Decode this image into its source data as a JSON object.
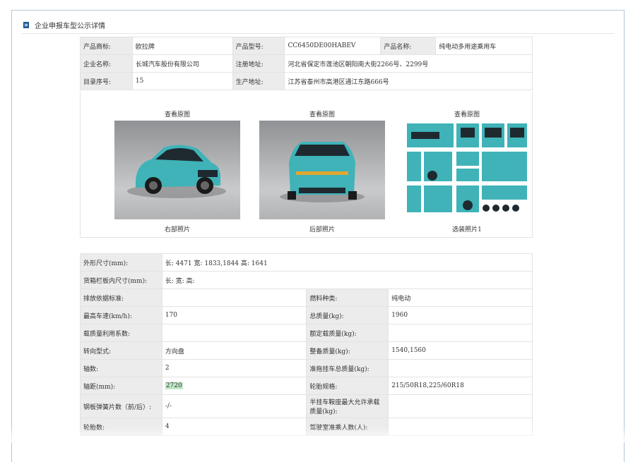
{
  "header": {
    "title": "企业申报车型公示详情"
  },
  "info": [
    [
      {
        "label": "产品商标:",
        "value": "欧拉牌"
      },
      {
        "label": "产品型号:",
        "value": "CC6450DE00HABEV"
      },
      {
        "label": "产品名称:",
        "value": "纯电动多用途乘用车"
      }
    ],
    [
      {
        "label": "企业名称:",
        "value": "长城汽车股份有限公司"
      },
      {
        "label": "注册地址:",
        "value": "河北省保定市莲池区朝阳南大街2266号、2299号"
      }
    ],
    [
      {
        "label": "目录序号:",
        "value": "15"
      },
      {
        "label": "生产地址:",
        "value": "江苏省泰州市高港区通江东路666号"
      }
    ]
  ],
  "photos": [
    {
      "top": "查看原图",
      "caption": "右部照片"
    },
    {
      "top": "查看原图",
      "caption": "后部照片"
    },
    {
      "top": "查看原图",
      "caption": "选装照片1"
    }
  ],
  "specs": {
    "dims_label": "外形尺寸(mm):",
    "dims_value": "长: 4471 宽: 1833,1844 高: 1641",
    "cargo_label": "货箱栏板内尺寸(mm):",
    "cargo_value": "长:   宽:   高:",
    "rows": [
      {
        "l1": "排放依据标准:",
        "v1": "",
        "l2": "燃料种类:",
        "v2": "纯电动"
      },
      {
        "l1": "最高车速(km/h):",
        "v1": "170",
        "l2": "总质量(kg):",
        "v2": "1960"
      },
      {
        "l1": "载质量利用系数:",
        "v1": "",
        "l2": "额定载质量(kg):",
        "v2": ""
      },
      {
        "l1": "转向型式:",
        "v1": "方向盘",
        "l2": "整备质量(kg):",
        "v2": "1540,1560"
      },
      {
        "l1": "轴数:",
        "v1": "2",
        "l2": "准拖挂车总质量(kg):",
        "v2": ""
      },
      {
        "l1": "轴距(mm):",
        "v1": "2720",
        "l2": "轮胎规格:",
        "v2": "215/50R18,225/60R18"
      },
      {
        "l1": "钢板弹簧片数（前/后）:",
        "v1": "-/-",
        "l2": "半挂车鞍座最大允许承载质量(kg):",
        "v2": ""
      },
      {
        "l1": "轮胎数:",
        "v1": "4",
        "l2": "驾驶室准乘人数(人):",
        "v2": ""
      }
    ]
  },
  "colors": {
    "accent": "#2b67a8",
    "label_bg": "#ececec",
    "border": "#e3e3e3",
    "highlight": "#bfe8c8"
  }
}
